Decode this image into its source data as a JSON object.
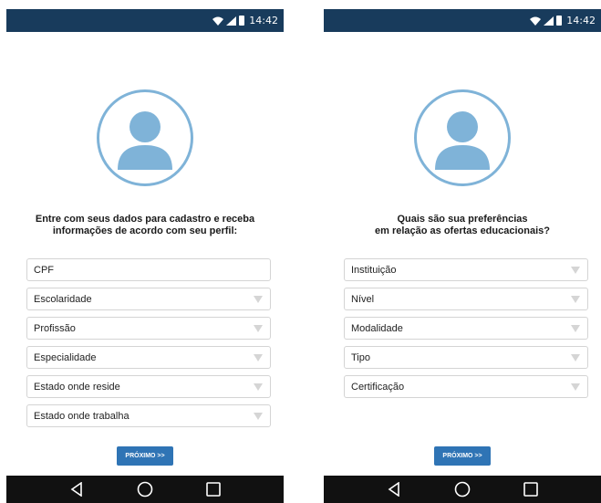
{
  "screens": [
    {
      "status_time": "14:42",
      "heading": "Entre com seus  dados para cadastro e receba\ninformações de acordo com seu perfil:",
      "fields": [
        {
          "label": "CPF",
          "dropdown": false
        },
        {
          "label": "Escolaridade",
          "dropdown": true
        },
        {
          "label": "Profissão",
          "dropdown": true
        },
        {
          "label": "Especialidade",
          "dropdown": true
        },
        {
          "label": "Estado onde reside",
          "dropdown": true
        },
        {
          "label": "Estado onde trabalha",
          "dropdown": true
        }
      ],
      "next_label": "PRÓXIMO >>"
    },
    {
      "status_time": "14:42",
      "heading": "Quais são sua preferências\nem relação as ofertas educacionais?",
      "fields": [
        {
          "label": "Instituição",
          "dropdown": true
        },
        {
          "label": "Nível",
          "dropdown": true
        },
        {
          "label": "Modalidade",
          "dropdown": true
        },
        {
          "label": "Tipo",
          "dropdown": true
        },
        {
          "label": "Certificação",
          "dropdown": true
        }
      ],
      "next_label": "PRÓXIMO >>"
    }
  ],
  "colors": {
    "status_bar": "#183b5c",
    "avatar": "#7fb3d8",
    "button": "#2f74b5",
    "nav_bar": "#111111"
  },
  "icons": {
    "status": [
      "wifi-icon",
      "signal-icon",
      "battery-icon"
    ],
    "nav": [
      "back-icon",
      "home-icon",
      "recents-icon"
    ]
  }
}
